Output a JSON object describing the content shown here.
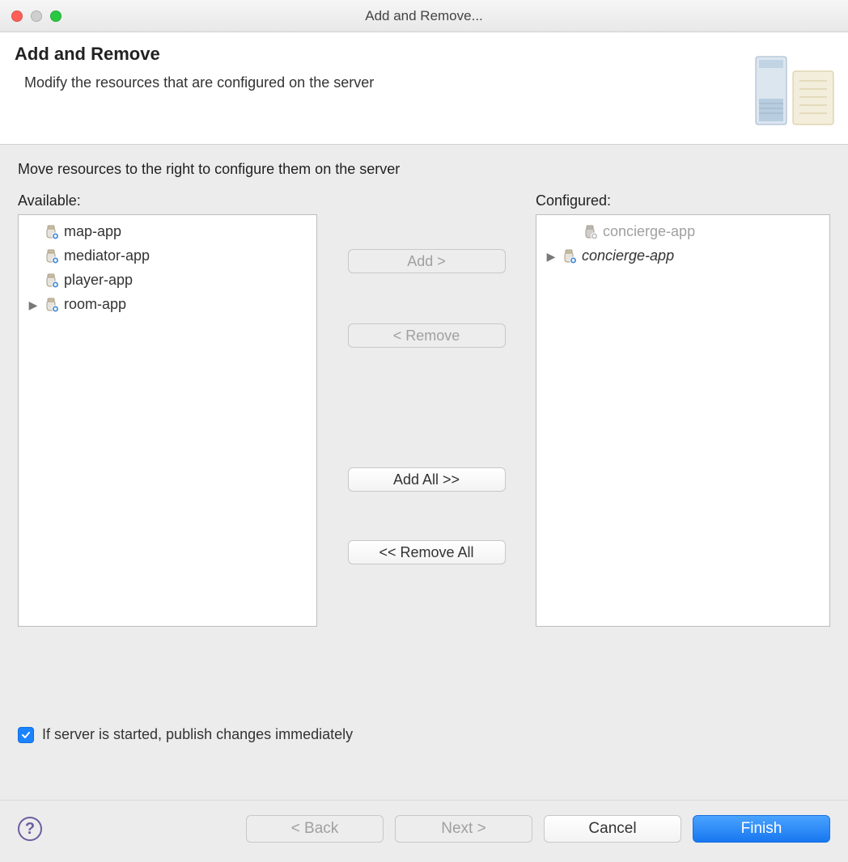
{
  "window": {
    "title": "Add and Remove..."
  },
  "banner": {
    "title": "Add and Remove",
    "description": "Modify the resources that are configured on the server"
  },
  "instruction": "Move resources to the right to configure them on the server",
  "available": {
    "label": "Available:",
    "items": [
      {
        "label": "map-app",
        "expandable": false
      },
      {
        "label": "mediator-app",
        "expandable": false
      },
      {
        "label": "player-app",
        "expandable": false
      },
      {
        "label": "room-app",
        "expandable": true
      }
    ]
  },
  "configured": {
    "label": "Configured:",
    "items": [
      {
        "label": "concierge-app",
        "ghost": true,
        "expandable": false,
        "indent": true
      },
      {
        "label": "concierge-app",
        "ghost": false,
        "expandable": true,
        "italic": true
      }
    ]
  },
  "buttons": {
    "add": "Add >",
    "remove": "< Remove",
    "add_all": "Add All >>",
    "remove_all": "<< Remove All"
  },
  "checkbox": {
    "checked": true,
    "label": "If server is started, publish changes immediately"
  },
  "footer": {
    "back": "< Back",
    "next": "Next >",
    "cancel": "Cancel",
    "finish": "Finish"
  }
}
